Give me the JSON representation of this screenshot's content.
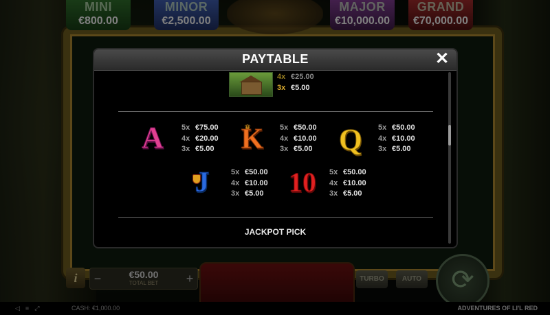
{
  "game": {
    "title": "ADVENTURES OF LI'L RED",
    "cash_label": "CASH:",
    "cash_value": "€1,000.00"
  },
  "jackpots": {
    "mini": {
      "name": "MINI",
      "amount": "€800.00"
    },
    "minor": {
      "name": "MINOR",
      "amount": "€2,500.00"
    },
    "major": {
      "name": "MAJOR",
      "amount": "€10,000.00"
    },
    "grand": {
      "name": "GRAND",
      "amount": "€70,000.00"
    }
  },
  "controls": {
    "info_label": "i",
    "minus_label": "−",
    "plus_label": "+",
    "bet_amount": "€50.00",
    "bet_label": "TOTAL BET",
    "turbo_label": "TURBO",
    "auto_label": "AUTO",
    "spin_icon": "refresh-arrows-icon"
  },
  "paytable": {
    "title": "PAYTABLE",
    "close_label": "✕",
    "cabin_pays": [
      {
        "count": "4x",
        "amount": "€25.00"
      },
      {
        "count": "3x",
        "amount": "€5.00"
      }
    ],
    "symbols": [
      {
        "symbol": "A",
        "pays": [
          {
            "count": "5x",
            "amount": "€75.00"
          },
          {
            "count": "4x",
            "amount": "€20.00"
          },
          {
            "count": "3x",
            "amount": "€5.00"
          }
        ]
      },
      {
        "symbol": "K",
        "pays": [
          {
            "count": "5x",
            "amount": "€50.00"
          },
          {
            "count": "4x",
            "amount": "€10.00"
          },
          {
            "count": "3x",
            "amount": "€5.00"
          }
        ]
      },
      {
        "symbol": "Q",
        "pays": [
          {
            "count": "5x",
            "amount": "€50.00"
          },
          {
            "count": "4x",
            "amount": "€10.00"
          },
          {
            "count": "3x",
            "amount": "€5.00"
          }
        ]
      },
      {
        "symbol": "J",
        "pays": [
          {
            "count": "5x",
            "amount": "€50.00"
          },
          {
            "count": "4x",
            "amount": "€10.00"
          },
          {
            "count": "3x",
            "amount": "€5.00"
          }
        ]
      },
      {
        "symbol": "10",
        "pays": [
          {
            "count": "5x",
            "amount": "€50.00"
          },
          {
            "count": "4x",
            "amount": "€10.00"
          },
          {
            "count": "3x",
            "amount": "€5.00"
          }
        ]
      }
    ],
    "jackpot_pick_heading": "JACKPOT PICK"
  },
  "colors": {
    "modal_bg": "#000000",
    "header_bg": "#3a3a3a",
    "highlight_count": "#e0b030",
    "symbol_a": "#e04090",
    "symbol_k": "#f07020",
    "symbol_q": "#f0c020",
    "symbol_j": "#2a6ae0",
    "symbol_10": "#e02020"
  }
}
